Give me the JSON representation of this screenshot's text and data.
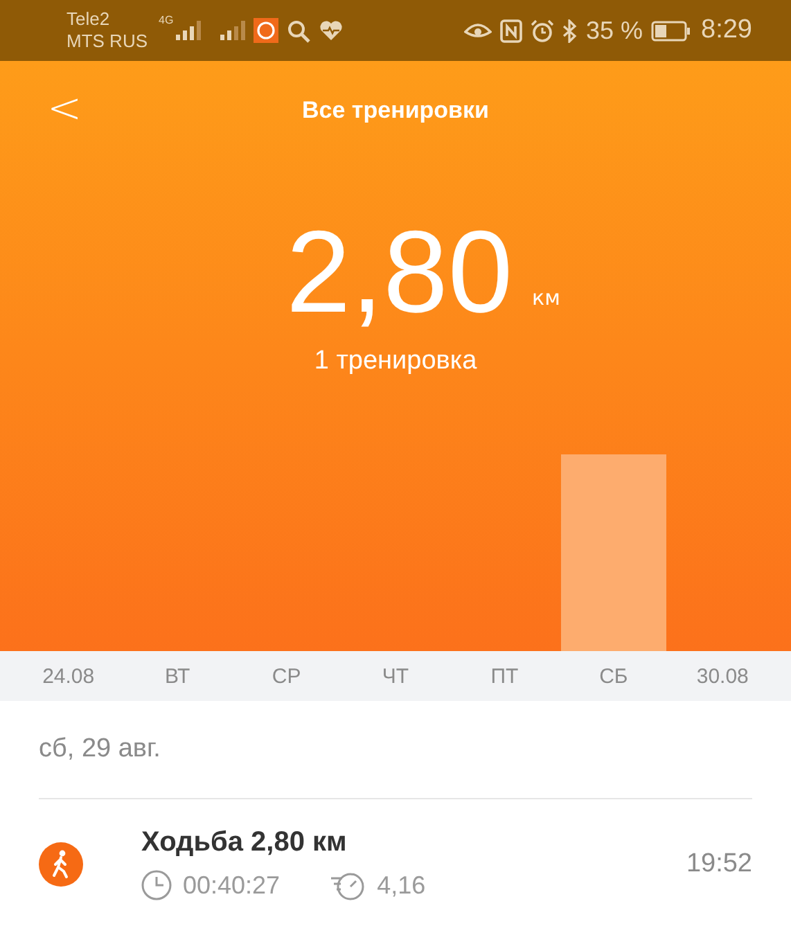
{
  "status_bar": {
    "carriers": [
      "Tele2",
      "MTS RUS"
    ],
    "network": "4G",
    "battery_text": "35 %",
    "time": "8:29"
  },
  "header": {
    "back": "<",
    "title": "Все тренировки"
  },
  "summary": {
    "value": "2,80",
    "unit": "км",
    "count": "1 тренировка"
  },
  "days": [
    {
      "label": "24.08",
      "has_workout": false
    },
    {
      "label": "ВТ",
      "has_workout": false
    },
    {
      "label": "СР",
      "has_workout": false
    },
    {
      "label": "ЧТ",
      "has_workout": false
    },
    {
      "label": "ПТ",
      "has_workout": false
    },
    {
      "label": "СБ",
      "has_workout": true
    },
    {
      "label": "30.08",
      "has_workout": false
    }
  ],
  "day": {
    "date": "сб, 29 авг."
  },
  "workouts": [
    {
      "title": "Ходьба 2,80 км",
      "duration": "00:40:27",
      "pace": "4,16",
      "time": "19:52"
    }
  ]
}
